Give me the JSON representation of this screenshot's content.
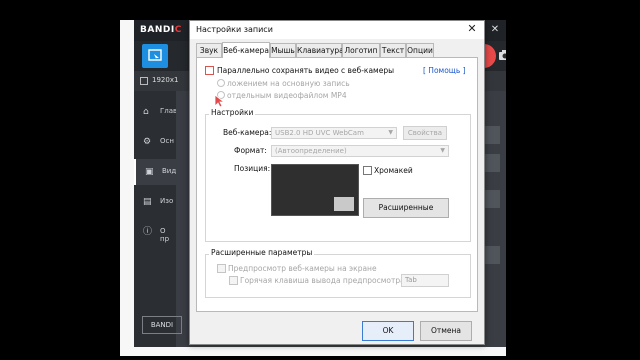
{
  "bandicam": {
    "logo_main": "BANDI",
    "logo_accent": "C",
    "resolution": "1920x1",
    "sidebar": [
      {
        "icon": "home-icon",
        "label": "Глав"
      },
      {
        "icon": "gear-icon",
        "label": "Осн"
      },
      {
        "icon": "video-icon",
        "label": "Вид"
      },
      {
        "icon": "image-icon",
        "label": "Изо"
      },
      {
        "icon": "info-icon",
        "label": "О пр"
      }
    ],
    "footer_label": "BANDI"
  },
  "dialog": {
    "title": "Настройки записи",
    "close": "✕",
    "tabs": [
      "Звук",
      "Веб-камера",
      "Мышь",
      "Клавиатура",
      "Логотип",
      "Текст",
      "Опции"
    ],
    "active_tab": "Веб-камера",
    "overlay_checkbox": "Параллельно сохранять видео с веб-камеры",
    "help_link": "[ Помощь ]",
    "radio_overlay": "ложением на основную запись",
    "radio_separate": "отдельным видеофайлом MP4",
    "settings_group": "Настройки",
    "webcam_label": "Веб-камера:",
    "webcam_value": "USB2.0 HD UVC WebCam",
    "properties_button": "Свойства",
    "format_label": "Формат:",
    "format_value": "(Автоопределение)",
    "position_label": "Позиция:",
    "chromakey_label": "Хромакей",
    "advanced_button": "Расширенные",
    "advanced_group": "Расширенные параметры",
    "preview_checkbox": "Предпросмотр веб-камеры на экране",
    "hotkey_checkbox": "Горячая клавиша вывода предпросмотра:",
    "hotkey_value": "Tab",
    "ok_button": "OK",
    "cancel_button": "Отмена"
  },
  "colors": {
    "accent_blue": "#1e8fe0",
    "record_red": "#e84a4a",
    "link": "#1a56c9"
  }
}
